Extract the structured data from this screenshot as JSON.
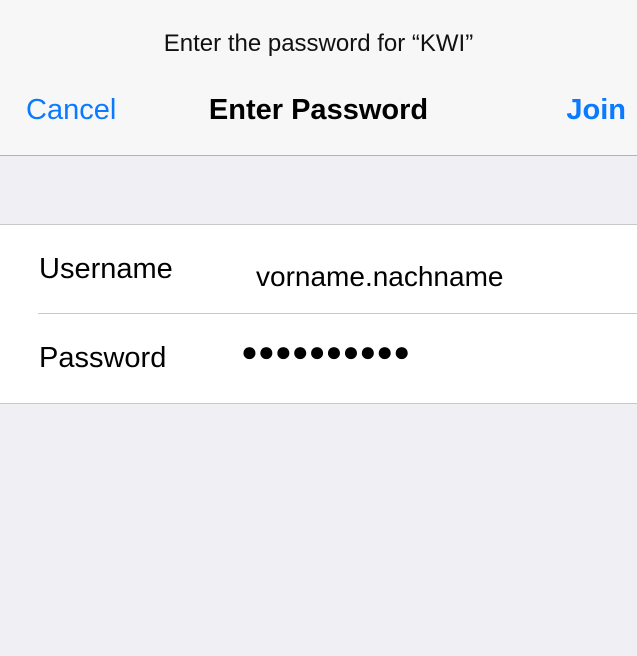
{
  "navbar": {
    "prompt": "Enter the password for “KWI”",
    "cancel_label": "Cancel",
    "title": "Enter Password",
    "join_label": "Join"
  },
  "form": {
    "username": {
      "label": "Username",
      "value": "vorname.nachname"
    },
    "password": {
      "label": "Password",
      "value": "●●●●●●●●●●"
    }
  },
  "colors": {
    "accent": "#0a7aff",
    "background": "#efeff4",
    "navbar": "#f7f7f7"
  }
}
